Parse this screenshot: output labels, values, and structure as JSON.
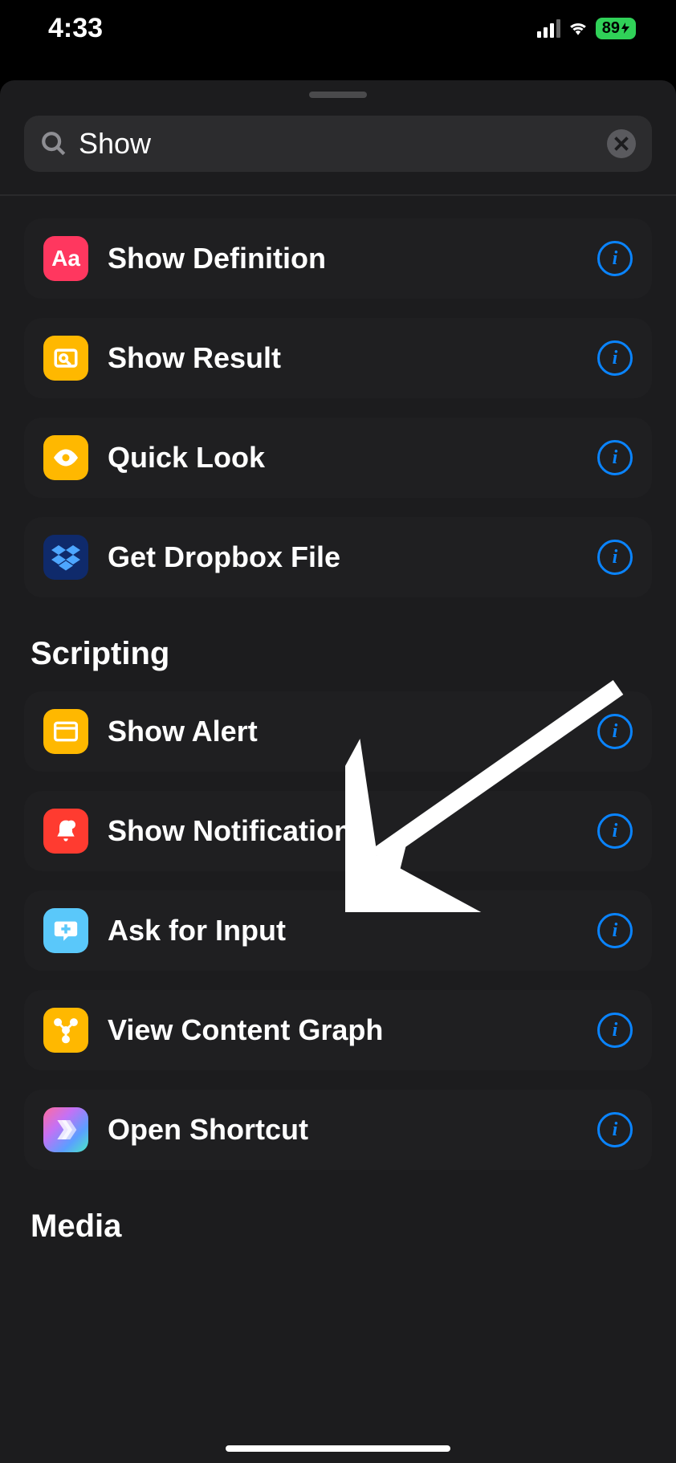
{
  "status": {
    "time": "4:33",
    "battery": "89"
  },
  "search": {
    "value": "Show"
  },
  "section1": {
    "items": [
      {
        "label": "Show Definition"
      },
      {
        "label": "Show Result"
      },
      {
        "label": "Quick Look"
      },
      {
        "label": "Get Dropbox File"
      }
    ]
  },
  "section2": {
    "header": "Scripting",
    "items": [
      {
        "label": "Show Alert"
      },
      {
        "label": "Show Notification"
      },
      {
        "label": "Ask for Input"
      },
      {
        "label": "View Content Graph"
      },
      {
        "label": "Open Shortcut"
      }
    ]
  },
  "section3": {
    "header": "Media"
  }
}
